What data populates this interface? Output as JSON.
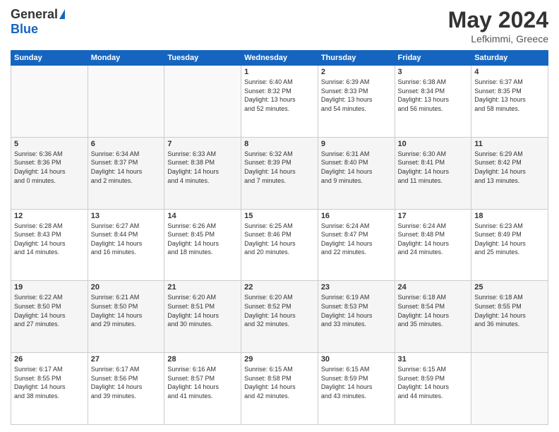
{
  "header": {
    "logo_general": "General",
    "logo_blue": "Blue",
    "title": "May 2024",
    "location": "Lefkimmi, Greece"
  },
  "calendar": {
    "days": [
      "Sunday",
      "Monday",
      "Tuesday",
      "Wednesday",
      "Thursday",
      "Friday",
      "Saturday"
    ],
    "weeks": [
      [
        {
          "num": "",
          "info": ""
        },
        {
          "num": "",
          "info": ""
        },
        {
          "num": "",
          "info": ""
        },
        {
          "num": "1",
          "info": "Sunrise: 6:40 AM\nSunset: 8:32 PM\nDaylight: 13 hours\nand 52 minutes."
        },
        {
          "num": "2",
          "info": "Sunrise: 6:39 AM\nSunset: 8:33 PM\nDaylight: 13 hours\nand 54 minutes."
        },
        {
          "num": "3",
          "info": "Sunrise: 6:38 AM\nSunset: 8:34 PM\nDaylight: 13 hours\nand 56 minutes."
        },
        {
          "num": "4",
          "info": "Sunrise: 6:37 AM\nSunset: 8:35 PM\nDaylight: 13 hours\nand 58 minutes."
        }
      ],
      [
        {
          "num": "5",
          "info": "Sunrise: 6:36 AM\nSunset: 8:36 PM\nDaylight: 14 hours\nand 0 minutes."
        },
        {
          "num": "6",
          "info": "Sunrise: 6:34 AM\nSunset: 8:37 PM\nDaylight: 14 hours\nand 2 minutes."
        },
        {
          "num": "7",
          "info": "Sunrise: 6:33 AM\nSunset: 8:38 PM\nDaylight: 14 hours\nand 4 minutes."
        },
        {
          "num": "8",
          "info": "Sunrise: 6:32 AM\nSunset: 8:39 PM\nDaylight: 14 hours\nand 7 minutes."
        },
        {
          "num": "9",
          "info": "Sunrise: 6:31 AM\nSunset: 8:40 PM\nDaylight: 14 hours\nand 9 minutes."
        },
        {
          "num": "10",
          "info": "Sunrise: 6:30 AM\nSunset: 8:41 PM\nDaylight: 14 hours\nand 11 minutes."
        },
        {
          "num": "11",
          "info": "Sunrise: 6:29 AM\nSunset: 8:42 PM\nDaylight: 14 hours\nand 13 minutes."
        }
      ],
      [
        {
          "num": "12",
          "info": "Sunrise: 6:28 AM\nSunset: 8:43 PM\nDaylight: 14 hours\nand 14 minutes."
        },
        {
          "num": "13",
          "info": "Sunrise: 6:27 AM\nSunset: 8:44 PM\nDaylight: 14 hours\nand 16 minutes."
        },
        {
          "num": "14",
          "info": "Sunrise: 6:26 AM\nSunset: 8:45 PM\nDaylight: 14 hours\nand 18 minutes."
        },
        {
          "num": "15",
          "info": "Sunrise: 6:25 AM\nSunset: 8:46 PM\nDaylight: 14 hours\nand 20 minutes."
        },
        {
          "num": "16",
          "info": "Sunrise: 6:24 AM\nSunset: 8:47 PM\nDaylight: 14 hours\nand 22 minutes."
        },
        {
          "num": "17",
          "info": "Sunrise: 6:24 AM\nSunset: 8:48 PM\nDaylight: 14 hours\nand 24 minutes."
        },
        {
          "num": "18",
          "info": "Sunrise: 6:23 AM\nSunset: 8:49 PM\nDaylight: 14 hours\nand 25 minutes."
        }
      ],
      [
        {
          "num": "19",
          "info": "Sunrise: 6:22 AM\nSunset: 8:50 PM\nDaylight: 14 hours\nand 27 minutes."
        },
        {
          "num": "20",
          "info": "Sunrise: 6:21 AM\nSunset: 8:50 PM\nDaylight: 14 hours\nand 29 minutes."
        },
        {
          "num": "21",
          "info": "Sunrise: 6:20 AM\nSunset: 8:51 PM\nDaylight: 14 hours\nand 30 minutes."
        },
        {
          "num": "22",
          "info": "Sunrise: 6:20 AM\nSunset: 8:52 PM\nDaylight: 14 hours\nand 32 minutes."
        },
        {
          "num": "23",
          "info": "Sunrise: 6:19 AM\nSunset: 8:53 PM\nDaylight: 14 hours\nand 33 minutes."
        },
        {
          "num": "24",
          "info": "Sunrise: 6:18 AM\nSunset: 8:54 PM\nDaylight: 14 hours\nand 35 minutes."
        },
        {
          "num": "25",
          "info": "Sunrise: 6:18 AM\nSunset: 8:55 PM\nDaylight: 14 hours\nand 36 minutes."
        }
      ],
      [
        {
          "num": "26",
          "info": "Sunrise: 6:17 AM\nSunset: 8:55 PM\nDaylight: 14 hours\nand 38 minutes."
        },
        {
          "num": "27",
          "info": "Sunrise: 6:17 AM\nSunset: 8:56 PM\nDaylight: 14 hours\nand 39 minutes."
        },
        {
          "num": "28",
          "info": "Sunrise: 6:16 AM\nSunset: 8:57 PM\nDaylight: 14 hours\nand 41 minutes."
        },
        {
          "num": "29",
          "info": "Sunrise: 6:15 AM\nSunset: 8:58 PM\nDaylight: 14 hours\nand 42 minutes."
        },
        {
          "num": "30",
          "info": "Sunrise: 6:15 AM\nSunset: 8:59 PM\nDaylight: 14 hours\nand 43 minutes."
        },
        {
          "num": "31",
          "info": "Sunrise: 6:15 AM\nSunset: 8:59 PM\nDaylight: 14 hours\nand 44 minutes."
        },
        {
          "num": "",
          "info": ""
        }
      ]
    ]
  }
}
